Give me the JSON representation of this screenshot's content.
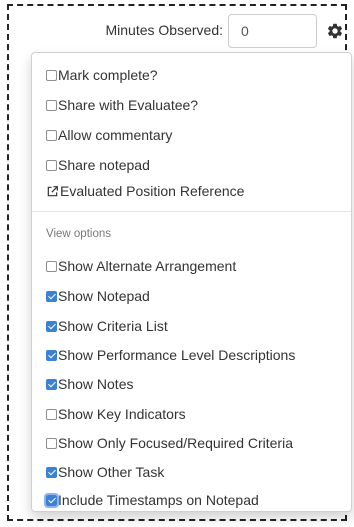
{
  "header": {
    "minutes_label": "Minutes Observed:",
    "minutes_value": "0",
    "settings_icon": "gear-icon"
  },
  "menu": {
    "actions": [
      {
        "label": "Mark complete?",
        "checked": false
      },
      {
        "label": "Share with Evaluatee?",
        "checked": false
      },
      {
        "label": "Allow commentary",
        "checked": false
      },
      {
        "label": "Share notepad",
        "checked": false
      }
    ],
    "reference_link": {
      "label": "Evaluated Position Reference",
      "icon": "external-link-icon"
    },
    "view_options_header": "View options",
    "view_options": [
      {
        "label": "Show Alternate Arrangement",
        "checked": false
      },
      {
        "label": "Show Notepad",
        "checked": true
      },
      {
        "label": "Show Criteria List",
        "checked": true
      },
      {
        "label": "Show Performance Level Descriptions",
        "checked": true
      },
      {
        "label": "Show Notes",
        "checked": true
      },
      {
        "label": "Show Key Indicators",
        "checked": false
      },
      {
        "label": "Show Only Focused/Required Criteria",
        "checked": false
      },
      {
        "label": "Show Other Task",
        "checked": true
      },
      {
        "label": "Include Timestamps on Notepad",
        "checked": true
      }
    ]
  },
  "colors": {
    "checkbox_checked": "#3b82d6",
    "text": "#333333",
    "section_header": "#777777"
  }
}
